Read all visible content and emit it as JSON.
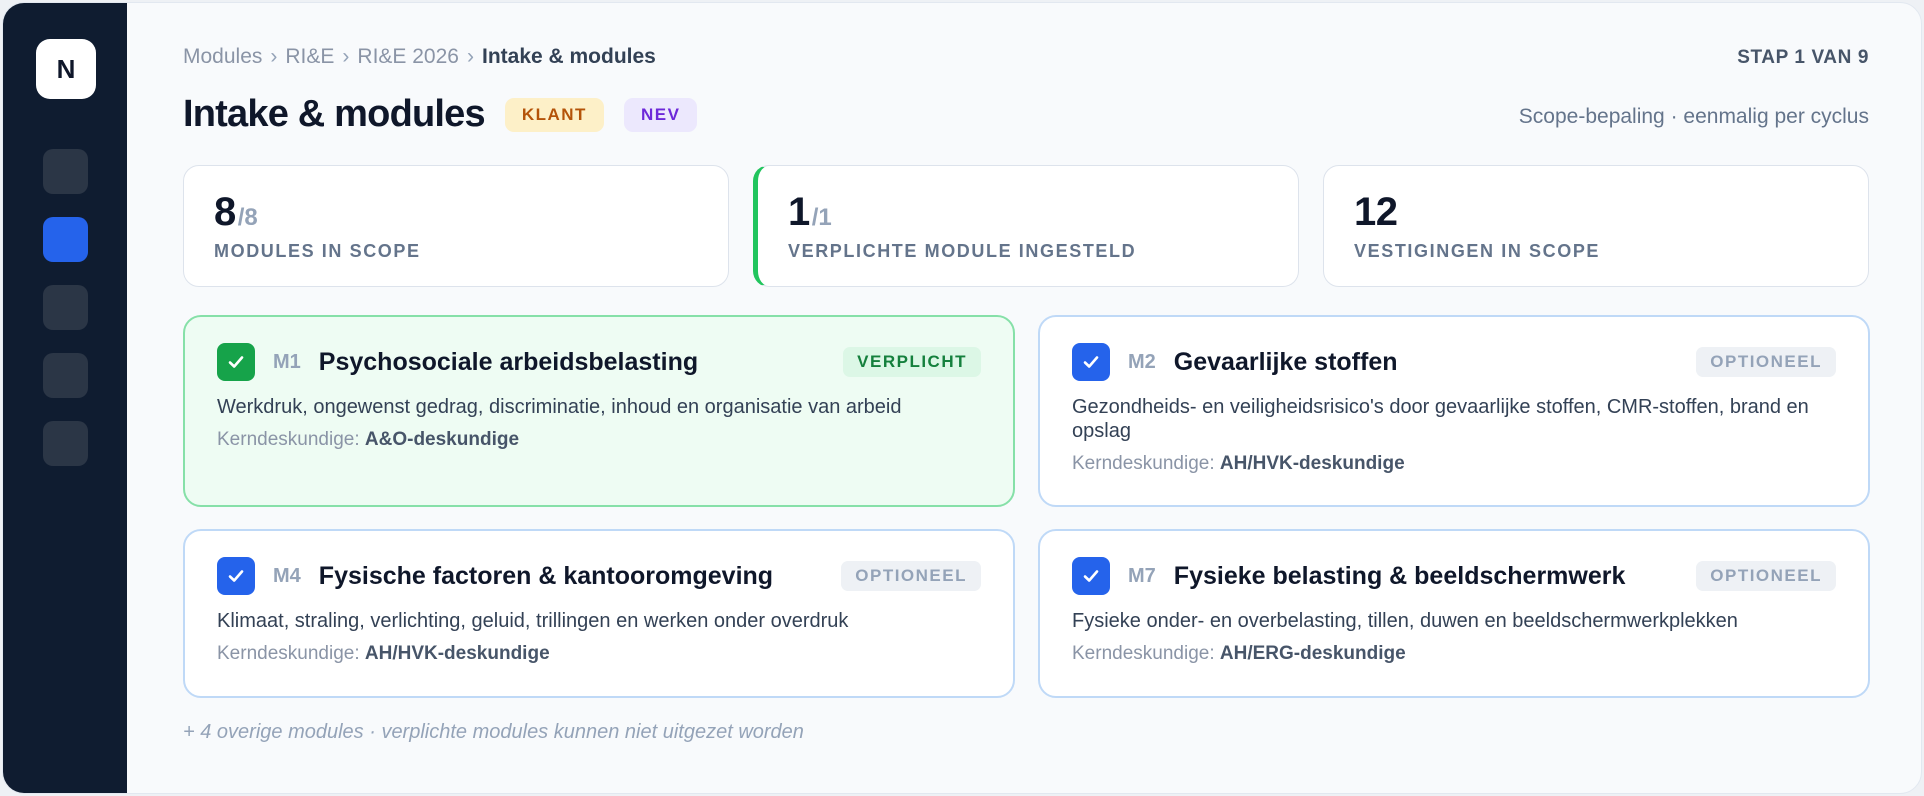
{
  "sidebar": {
    "logo": "N",
    "nav_items": [
      {
        "id": "nav-1",
        "active": false
      },
      {
        "id": "nav-2",
        "active": true
      },
      {
        "id": "nav-3",
        "active": false
      },
      {
        "id": "nav-4",
        "active": false
      },
      {
        "id": "nav-5",
        "active": false
      }
    ]
  },
  "breadcrumb": {
    "items": [
      "Modules",
      "RI&E",
      "RI&E 2026"
    ],
    "separator": "›",
    "current": "Intake & modules"
  },
  "step": "STAP 1 VAN 9",
  "page": {
    "title": "Intake & modules",
    "tags": {
      "klant": "KLANT",
      "nev": "NEV"
    },
    "scope_note": "Scope-bepaling · eenmalig per cyclus"
  },
  "stats": [
    {
      "value": "8",
      "total": "/8",
      "label": "MODULES IN SCOPE"
    },
    {
      "value": "1",
      "total": "/1",
      "label": "VERPLICHTE MODULE INGESTELD"
    },
    {
      "value": "12",
      "total": "",
      "label": "VESTIGINGEN IN SCOPE"
    }
  ],
  "modules": [
    {
      "code": "M1",
      "title": "Psychosociale arbeidsbelasting",
      "badge": "VERPLICHT",
      "description": "Werkdruk, ongewenst gedrag, discriminatie, inhoud en organisatie van arbeid",
      "expert_label": "Kerndeskundige:",
      "expert": "A&O-deskundige",
      "checked": true,
      "mandatory": true
    },
    {
      "code": "M2",
      "title": "Gevaarlijke stoffen",
      "badge": "OPTIONEEL",
      "description": "Gezondheids- en veiligheidsrisico's door gevaarlijke stoffen, CMR-stoffen, brand en opslag",
      "expert_label": "Kerndeskundige:",
      "expert": "AH/HVK-deskundige",
      "checked": true,
      "mandatory": false
    },
    {
      "code": "M4",
      "title": "Fysische factoren & kantooromgeving",
      "badge": "OPTIONEEL",
      "description": "Klimaat, straling, verlichting, geluid, trillingen en werken onder overdruk",
      "expert_label": "Kerndeskundige:",
      "expert": "AH/HVK-deskundige",
      "checked": true,
      "mandatory": false
    },
    {
      "code": "M7",
      "title": "Fysieke belasting & beeldschermwerk",
      "badge": "OPTIONEEL",
      "description": "Fysieke onder- en overbelasting, tillen, duwen en beeldschermwerkplekken",
      "expert_label": "Kerndeskundige:",
      "expert": "AH/ERG-deskundige",
      "checked": true,
      "mandatory": false
    }
  ],
  "footnote": "+ 4 overige modules · verplichte modules kunnen niet uitgezet worden",
  "colors": {
    "sidebar_bg": "#0f1c30",
    "accent": "#2563eb",
    "success": "#16a34a",
    "klant_tag": "#b45309",
    "nev_tag": "#6d28d9"
  }
}
